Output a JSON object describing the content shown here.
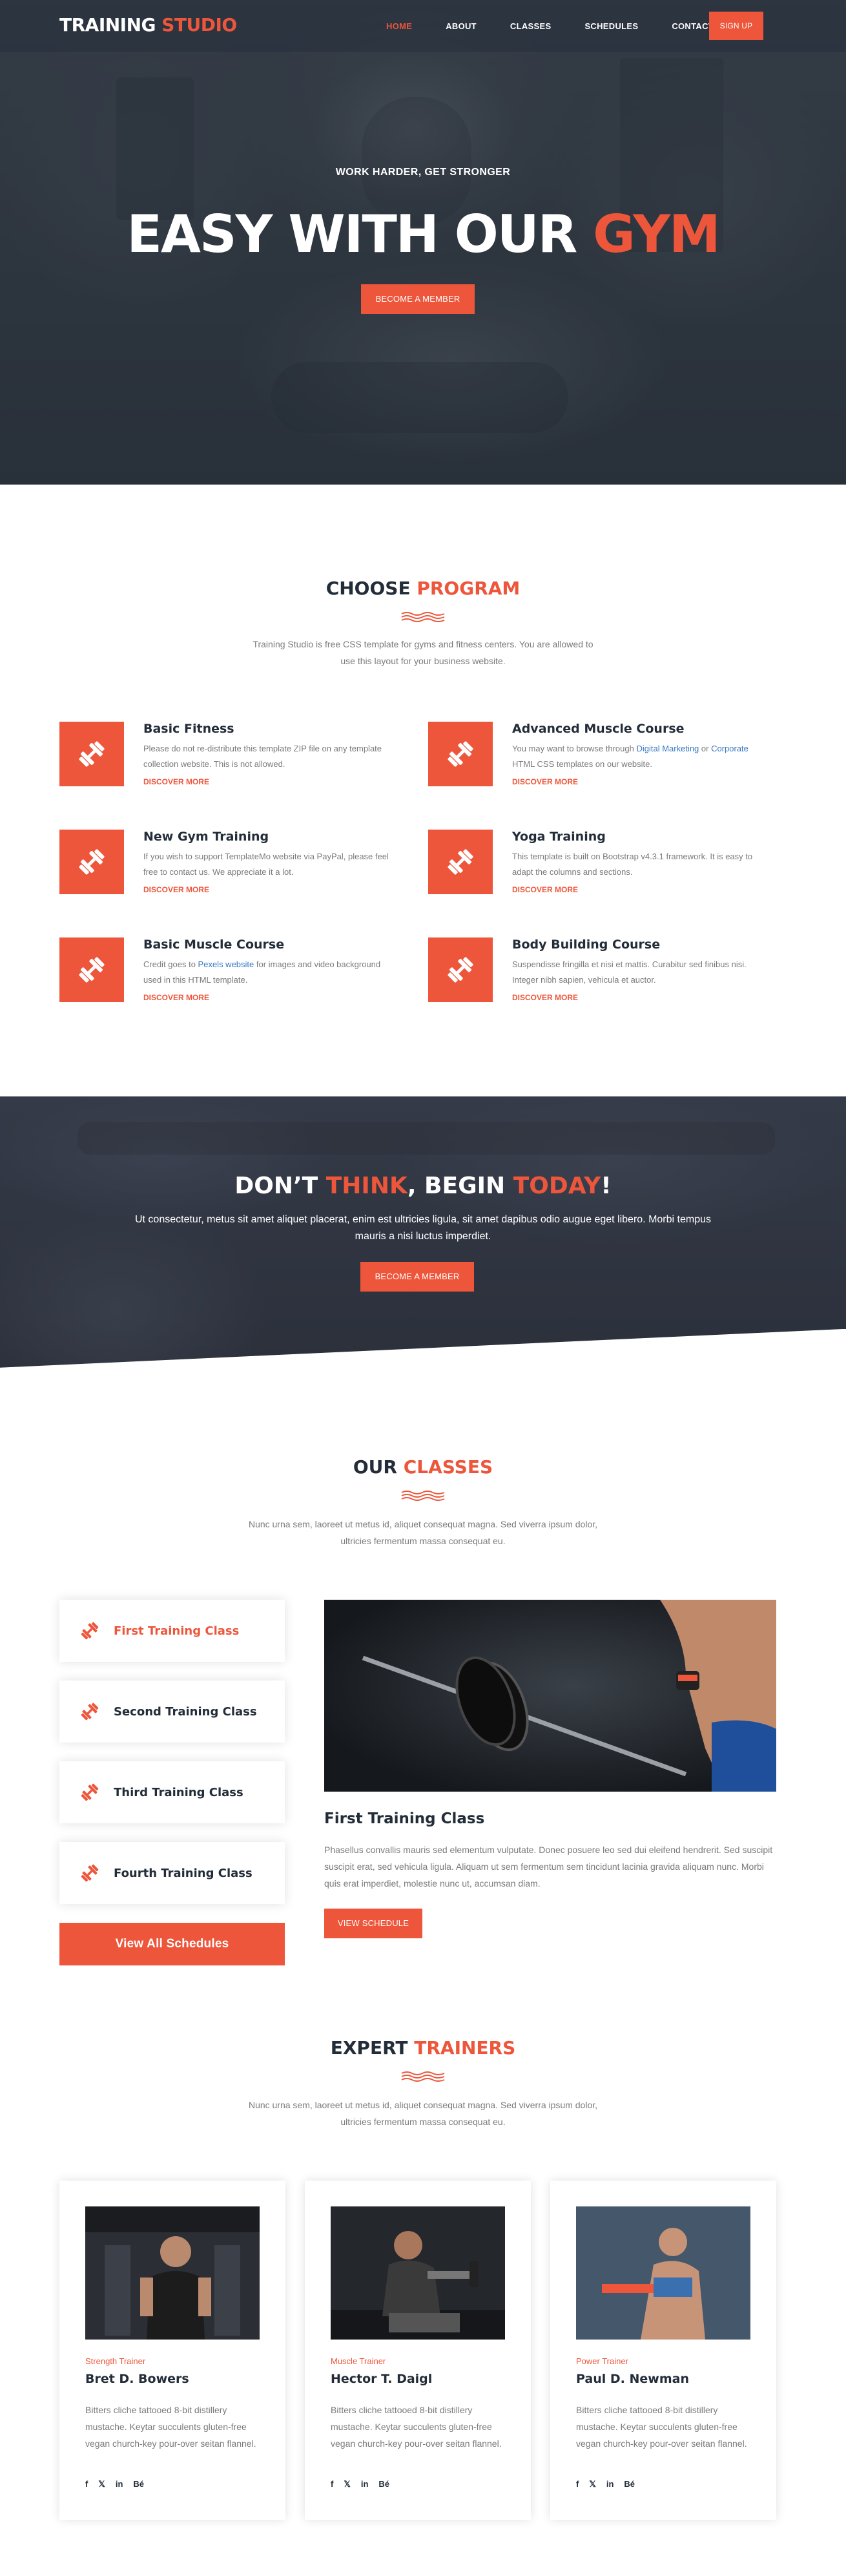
{
  "nav": {
    "logo_main": "TRAINING",
    "logo_accent": "STUDIO",
    "items": [
      {
        "label": "HOME",
        "active": true
      },
      {
        "label": "ABOUT",
        "active": false
      },
      {
        "label": "CLASSES",
        "active": false
      },
      {
        "label": "SCHEDULES",
        "active": false
      },
      {
        "label": "CONTACT",
        "active": false
      }
    ],
    "signup_label": "SIGN UP"
  },
  "hero": {
    "kicker": "WORK HARDER, GET STRONGER",
    "title_main": "EASY WITH OUR",
    "title_accent": "GYM",
    "cta_label": "BECOME A MEMBER"
  },
  "programs": {
    "heading_main": "CHOOSE",
    "heading_accent": "PROGRAM",
    "description": "Training Studio is free CSS template for gyms and fitness centers. You are allowed to use this layout for your business website.",
    "more_label": "DISCOVER MORE",
    "items": [
      {
        "title": "Basic Fitness",
        "text_before": "Please do not re-distribute this template ZIP file on any template collection website. This is not allowed.",
        "link1": "",
        "text_mid": "",
        "link2": "",
        "text_after": ""
      },
      {
        "title": "Advanced Muscle Course",
        "text_before": "You may want to browse through ",
        "link1": "Digital Marketing",
        "text_mid": " or ",
        "link2": "Corporate",
        "text_after": " HTML CSS templates on our website."
      },
      {
        "title": "New Gym Training",
        "text_before": "If you wish to support TemplateMo website via PayPal, please feel free to contact us. We appreciate it a lot.",
        "link1": "",
        "text_mid": "",
        "link2": "",
        "text_after": ""
      },
      {
        "title": "Yoga Training",
        "text_before": "This template is built on Bootstrap v4.3.1 framework. It is easy to adapt the columns and sections.",
        "link1": "",
        "text_mid": "",
        "link2": "",
        "text_after": ""
      },
      {
        "title": "Basic Muscle Course",
        "text_before": "Credit goes to ",
        "link1": "Pexels website",
        "text_mid": " for images and video background used in this HTML template.",
        "link2": "",
        "text_after": ""
      },
      {
        "title": "Body Building Course",
        "text_before": "Suspendisse fringilla et nisi et mattis. Curabitur sed finibus nisi. Integer nibh sapien, vehicula et auctor.",
        "link1": "",
        "text_mid": "",
        "link2": "",
        "text_after": ""
      }
    ]
  },
  "cta": {
    "h_part1": "DON’T ",
    "h_accent1": "THINK",
    "h_part2": ", BEGIN ",
    "h_accent2": "TODAY",
    "h_part3": "!",
    "description": "Ut consectetur, metus sit amet aliquet placerat, enim est ultricies ligula, sit amet dapibus odio augue eget libero. Morbi tempus mauris a nisi luctus imperdiet.",
    "button_label": "BECOME A MEMBER"
  },
  "classes": {
    "heading_main": "OUR",
    "heading_accent": "CLASSES",
    "description": "Nunc urna sem, laoreet ut metus id, aliquet consequat magna. Sed viverra ipsum dolor, ultricies fermentum massa consequat eu.",
    "tabs": [
      {
        "label": "First Training Class",
        "active": true
      },
      {
        "label": "Second Training Class",
        "active": false
      },
      {
        "label": "Third Training Class",
        "active": false
      },
      {
        "label": "Fourth Training Class",
        "active": false
      }
    ],
    "all_label": "View All Schedules",
    "selected_title": "First Training Class",
    "selected_desc": "Phasellus convallis mauris sed elementum vulputate. Donec posuere leo sed dui eleifend hendrerit. Sed suscipit suscipit erat, sed vehicula ligula. Aliquam ut sem fermentum sem tincidunt lacinia gravida aliquam nunc. Morbi quis erat imperdiet, molestie nunc ut, accumsan diam.",
    "view_label": "VIEW SCHEDULE"
  },
  "trainers": {
    "heading_main": "EXPERT",
    "heading_accent": "TRAINERS",
    "description": "Nunc urna sem, laoreet ut metus id, aliquet consequat magna. Sed viverra ipsum dolor, ultricies fermentum massa consequat eu.",
    "items": [
      {
        "role": "Strength Trainer",
        "name": "Bret D. Bowers",
        "bio": "Bitters cliche tattooed 8-bit distillery mustache. Keytar succulents gluten-free vegan church-key pour-over seitan flannel."
      },
      {
        "role": "Muscle Trainer",
        "name": "Hector T. Daigl",
        "bio": "Bitters cliche tattooed 8-bit distillery mustache. Keytar succulents gluten-free vegan church-key pour-over seitan flannel."
      },
      {
        "role": "Power Trainer",
        "name": "Paul D. Newman",
        "bio": "Bitters cliche tattooed 8-bit distillery mustache. Keytar succulents gluten-free vegan church-key pour-over seitan flannel."
      }
    ],
    "social": [
      "f",
      "𝕏",
      "in",
      "Bé"
    ]
  },
  "colors": {
    "accent": "#ed563b",
    "dark": "#232d39",
    "muted": "#7a7a7a",
    "link": "#3778c2"
  },
  "icons": {
    "program": "dumbbell-icon",
    "class_tab": "dumbbell-icon",
    "section_divider": "wave-icon"
  }
}
